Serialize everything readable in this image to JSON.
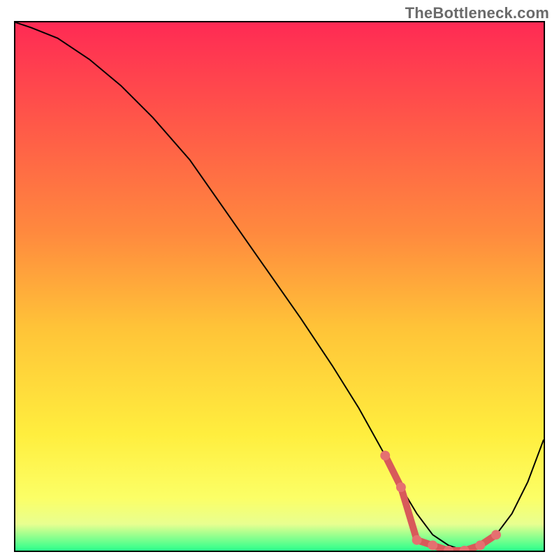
{
  "watermark": {
    "text": "TheBottleneck.com"
  },
  "colors": {
    "border": "#000000",
    "line": "#000000",
    "marker_fill": "#e57070",
    "marker_stroke": "#d85a5a",
    "gradient_stops": [
      {
        "offset": 0.0,
        "color": "#ff2a54"
      },
      {
        "offset": 0.2,
        "color": "#ff5a48"
      },
      {
        "offset": 0.4,
        "color": "#ff8a3e"
      },
      {
        "offset": 0.58,
        "color": "#ffc438"
      },
      {
        "offset": 0.78,
        "color": "#ffee3e"
      },
      {
        "offset": 0.9,
        "color": "#fcff66"
      },
      {
        "offset": 0.95,
        "color": "#e8ff90"
      },
      {
        "offset": 1.0,
        "color": "#2cff8c"
      }
    ]
  },
  "chart_data": {
    "type": "line",
    "title": "",
    "xlabel": "",
    "ylabel": "",
    "xlim": [
      0,
      100
    ],
    "ylim": [
      0,
      100
    ],
    "x": [
      0,
      3,
      8,
      14,
      20,
      26,
      33,
      40,
      47,
      54,
      60,
      65,
      70,
      73,
      76,
      79,
      82,
      85,
      88,
      91,
      94,
      97,
      100
    ],
    "values": [
      100,
      99,
      97,
      93,
      88,
      82,
      74,
      64,
      54,
      44,
      35,
      27,
      18,
      12,
      7,
      3,
      1,
      0,
      1,
      3,
      7,
      13,
      21
    ],
    "markers": {
      "x": [
        70,
        73,
        76,
        79,
        82,
        85,
        88,
        91
      ],
      "y": [
        18,
        12,
        2,
        1,
        0,
        0,
        1,
        3
      ]
    }
  }
}
